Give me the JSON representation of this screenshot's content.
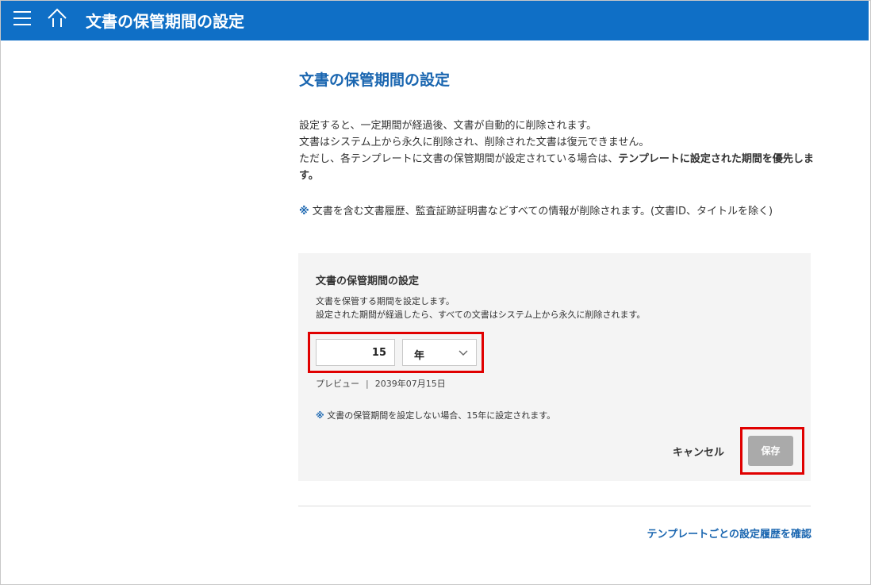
{
  "header": {
    "title": "文書の保管期間の設定",
    "menu_icon": "hamburger-icon",
    "home_icon": "home-icon",
    "bg_color": "#0f6fc6"
  },
  "page": {
    "title": "文書の保管期間の設定",
    "desc_line1": "設定すると、一定期間が経過後、文書が自動的に削除されます。",
    "desc_line2": "文書はシステム上から永久に削除され、削除された文書は復元できません。",
    "desc_line3_normal": "ただし、各テンプレートに文書の保管期間が設定されている場合は、",
    "desc_line3_bold": "テンプレートに設定された期間を優先します。",
    "note_mark": "※",
    "note_text": " 文書を含む文書履歴、監査証跡証明書などすべての情報が削除されます。(文書ID、タイトルを除く)"
  },
  "panel": {
    "title": "文書の保管期間の設定",
    "desc_line1": "文書を保管する期間を設定します。",
    "desc_line2": "設定された期間が経過したら、すべての文書はシステム上から永久に削除されます。",
    "period_value": "15",
    "unit_selected": "年",
    "preview_label": "プレビュー",
    "preview_separator": "|",
    "preview_date": "2039年07月15日",
    "note_mark": "※",
    "note_text": " 文書の保管期間を設定しない場合、15年に設定されます。",
    "cancel_label": "キャンセル",
    "save_label": "保存"
  },
  "footer": {
    "history_link": "テンプレートごとの設定履歴を確認"
  },
  "colors": {
    "accent": "#1a66b0",
    "highlight": "#e00000",
    "panel_bg": "#f4f4f4",
    "save_disabled": "#aaaaaa"
  }
}
